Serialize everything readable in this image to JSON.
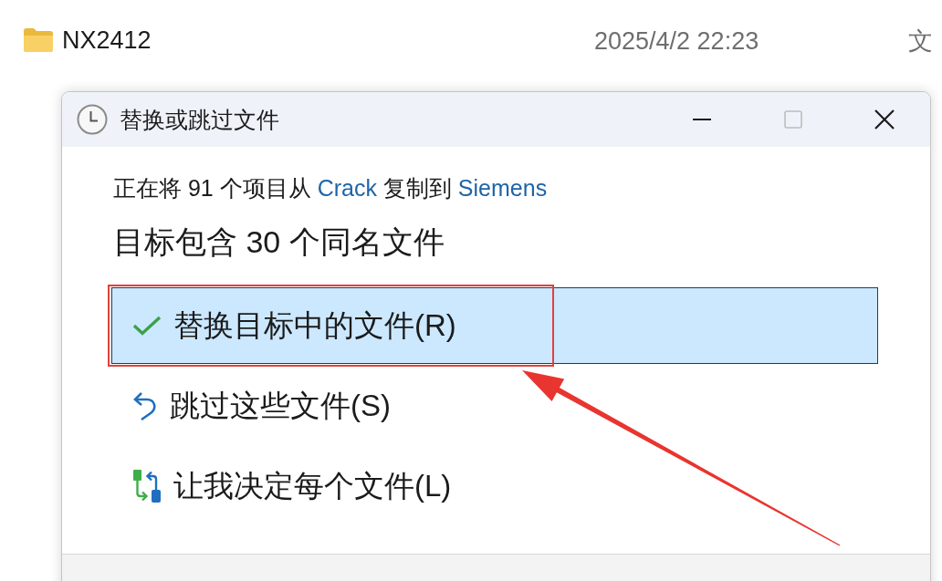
{
  "file_row": {
    "name": "NX2412",
    "modified": "2025/4/2 22:23",
    "column_3": "文"
  },
  "dialog": {
    "title": "替换或跳过文件",
    "window_controls": [
      {
        "kind": "minimize",
        "disabled": false
      },
      {
        "kind": "maximize",
        "disabled": true
      },
      {
        "kind": "close",
        "disabled": false
      }
    ],
    "copy_line": {
      "before": "正在将 91 个项目从",
      "source": "Crack",
      "middle": "复制到",
      "destination": "Siemens"
    },
    "heading": "目标包含 30 个同名文件",
    "options": [
      {
        "kind": "check",
        "label": "替换目标中的文件(R)",
        "selected": true,
        "annotated": true
      },
      {
        "kind": "skip",
        "label": "跳过这些文件(S)",
        "selected": false,
        "annotated": false
      },
      {
        "kind": "compare",
        "label": "让我决定每个文件(L)",
        "selected": false,
        "annotated": false
      }
    ]
  }
}
